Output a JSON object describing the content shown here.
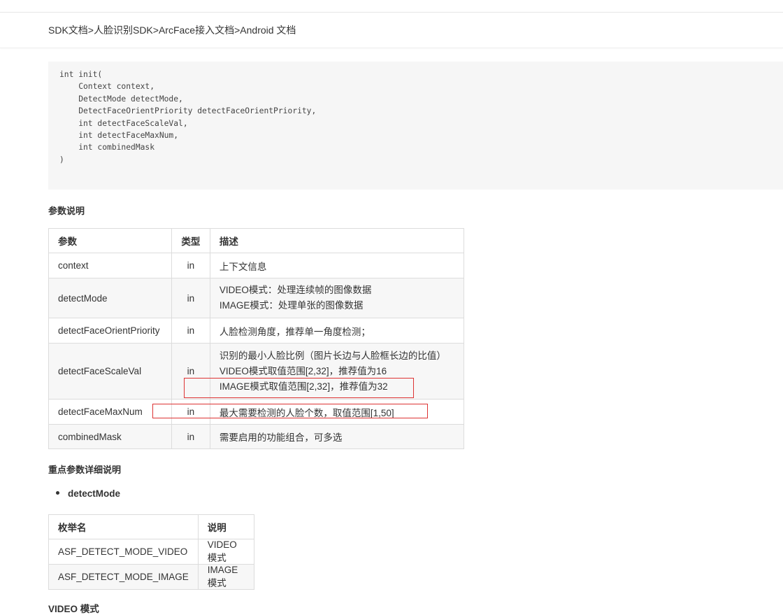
{
  "breadcrumb": {
    "items": [
      "SDK文档",
      "人脸识别SDK",
      "ArcFace接入文档",
      "Android 文档"
    ],
    "separator": ">"
  },
  "code": {
    "text": "int init(\n    Context context,\n    DetectMode detectMode,\n    DetectFaceOrientPriority detectFaceOrientPriority,\n    int detectFaceScaleVal,\n    int detectFaceMaxNum,\n    int combinedMask\n)"
  },
  "params_section": {
    "title": "参数说明",
    "headers": [
      "参数",
      "类型",
      "描述"
    ],
    "rows": [
      {
        "name": "context",
        "type": "in",
        "desc": [
          "上下文信息"
        ]
      },
      {
        "name": "detectMode",
        "type": "in",
        "desc": [
          "VIDEO模式：处理连续帧的图像数据",
          "IMAGE模式：处理单张的图像数据"
        ]
      },
      {
        "name": "detectFaceOrientPriority",
        "type": "in",
        "desc": [
          "人脸检测角度，推荐单一角度检测；"
        ]
      },
      {
        "name": "detectFaceScaleVal",
        "type": "in",
        "desc": [
          "识别的最小人脸比例（图片长边与人脸框长边的比值）",
          "VIDEO模式取值范围[2,32]，推荐值为16",
          "IMAGE模式取值范围[2,32]，推荐值为32"
        ]
      },
      {
        "name": "detectFaceMaxNum",
        "type": "in",
        "desc": [
          "最大需要检测的人脸个数，取值范围[1,50]"
        ]
      },
      {
        "name": "combinedMask",
        "type": "in",
        "desc": [
          "需要启用的功能组合，可多选"
        ]
      }
    ]
  },
  "detail_section": {
    "title": "重点参数详细说明",
    "bullet": "detectMode",
    "enum_headers": [
      "枚举名",
      "说明"
    ],
    "enum_rows": [
      {
        "name": "ASF_DETECT_MODE_VIDEO",
        "desc": "VIDEO模式"
      },
      {
        "name": "ASF_DETECT_MODE_IMAGE",
        "desc": "IMAGE模式"
      }
    ],
    "next_heading": "VIDEO 模式"
  },
  "colors": {
    "annotation_red": "#dd3333",
    "code_bg": "#f6f6f6",
    "border": "#dcdcdc"
  }
}
